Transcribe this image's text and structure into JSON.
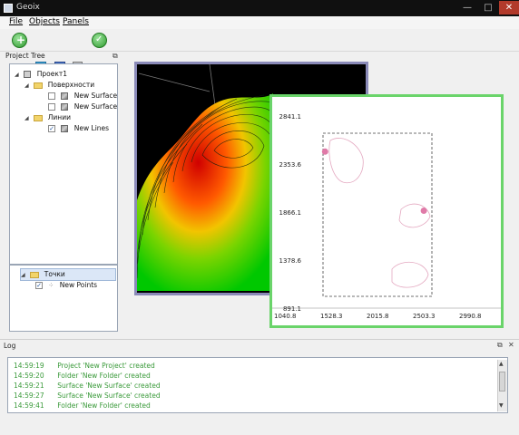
{
  "window": {
    "title": "Geoix",
    "minimize": "—",
    "maximize": "□",
    "close": "✕"
  },
  "menu": {
    "file": "File",
    "objects": "Objects",
    "panels": "Panels"
  },
  "toolbar": {
    "btn_2d": "2D",
    "btn_3d": "3D"
  },
  "project_tree": {
    "title": "Project Tree",
    "root": "Проект1",
    "surfaces_folder": "Поверхности",
    "surface_1": "New Surface",
    "surface_2": "New Surface",
    "lines_folder": "Линии",
    "lines_1": "New Lines"
  },
  "points_tree": {
    "folder": "Точки",
    "item": "New Points"
  },
  "plot2d": {
    "yticks": [
      "2841.1",
      "2353.6",
      "1866.1",
      "1378.6",
      "891.1"
    ],
    "xticks": [
      "1040.8",
      "1528.3",
      "2015.8",
      "2503.3",
      "2990.8"
    ]
  },
  "chart_data": {
    "type": "scatter",
    "x_ticks": [
      1040.8,
      1528.3,
      2015.8,
      2503.3,
      2990.8
    ],
    "y_ticks": [
      891.1,
      1378.6,
      1866.1,
      2353.6,
      2841.1
    ],
    "xlim": [
      1040.8,
      2990.8
    ],
    "ylim": [
      891.1,
      2841.1
    ],
    "points": [
      {
        "x": 1560,
        "y": 2480
      },
      {
        "x": 2600,
        "y": 1880
      }
    ],
    "grid": false
  },
  "log": {
    "title": "Log",
    "entries": [
      {
        "time": "14:59:19",
        "msg": "Project 'New Project' created"
      },
      {
        "time": "14:59:20",
        "msg": "Folder 'New Folder' created"
      },
      {
        "time": "14:59:21",
        "msg": "Surface 'New Surface' created"
      },
      {
        "time": "14:59:27",
        "msg": "Surface 'New Surface' created"
      },
      {
        "time": "14:59:41",
        "msg": "Folder 'New Folder' created"
      }
    ]
  },
  "colors": {
    "log_text": "#3a9a3a",
    "view3d_border": "#8a8ab8",
    "view2d_border": "#6ad46a",
    "point": "#e07aa8"
  }
}
